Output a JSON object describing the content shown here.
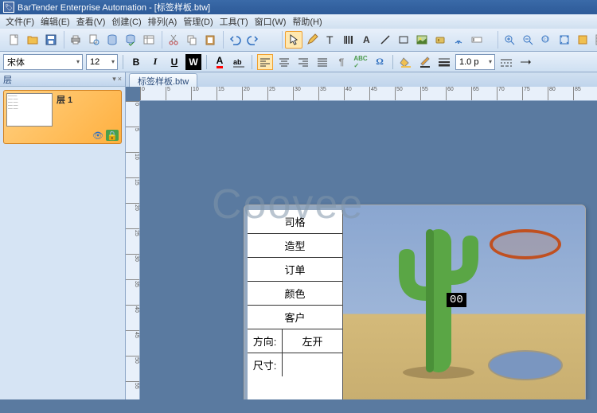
{
  "app": {
    "title": "BarTender Enterprise Automation - [标签样板.btw]"
  },
  "menu": {
    "file": "文件(F)",
    "edit": "编辑(E)",
    "view": "查看(V)",
    "create": "创建(C)",
    "arrange": "排列(A)",
    "admin": "管理(D)",
    "tools": "工具(T)",
    "window": "窗口(W)",
    "help": "帮助(H)"
  },
  "format": {
    "font": "宋体",
    "size": "12",
    "bold": "B",
    "italic": "I",
    "underline": "U",
    "white_on_black": "W",
    "line_weight": "1.0 p"
  },
  "side": {
    "title": "层",
    "pin": "▾",
    "close": "×",
    "layer_name": "层 1"
  },
  "tab": {
    "label": "标签样板.btw"
  },
  "ruler_h": [
    "0",
    "5",
    "10",
    "15",
    "20",
    "25",
    "30",
    "35",
    "40",
    "45",
    "50",
    "55",
    "60",
    "65",
    "70",
    "75",
    "80",
    "85"
  ],
  "ruler_v": [
    "0",
    "5",
    "10",
    "15",
    "20",
    "25",
    "30",
    "35",
    "40",
    "45",
    "50",
    "55"
  ],
  "label": {
    "rows": {
      "r1": "司格",
      "r2": "造型",
      "r3": "订单",
      "r4": "颜色",
      "r5": "客户"
    },
    "direction_label": "方向:",
    "direction_value": "左开",
    "size_label": "尺寸:",
    "size_value": "",
    "count": "00"
  },
  "watermark": "Coovee"
}
